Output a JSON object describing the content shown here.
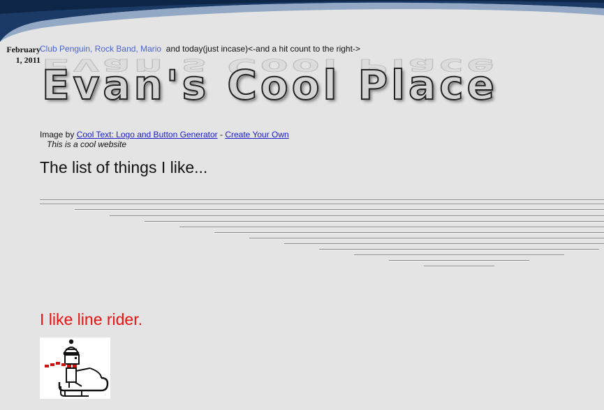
{
  "post": {
    "date_month": "February",
    "date_day_year": "1, 2011",
    "intro_links": "Club Penguin, Rock Band, Mario",
    "intro_rest": "and today(just incase)<-and a hit count to the right->"
  },
  "logo": {
    "text": "Evan's Cool Place"
  },
  "credit": {
    "prefix": "Image by",
    "link1": "Cool Text: Logo and Button Generator",
    "separator": "-",
    "link2": "Create Your Own"
  },
  "tagline": "This is a cool website",
  "list_heading": "The list of things I like...",
  "line_rider_heading": "I like line rider.",
  "colors": {
    "link": "#1a1acc",
    "intro_link": "#4b63d6",
    "red_heading": "#ee1111",
    "banner_dark": "#1b3a66"
  }
}
